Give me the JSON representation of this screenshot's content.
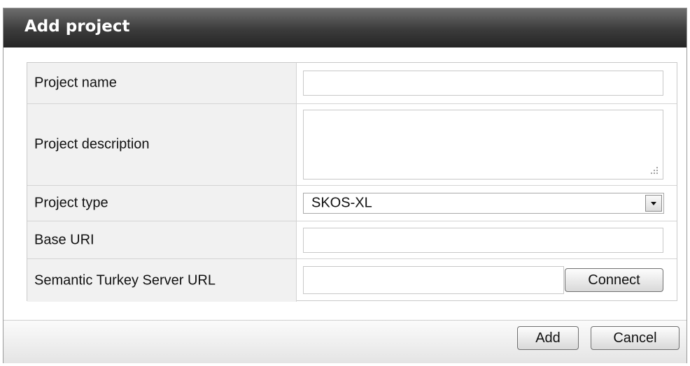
{
  "dialog": {
    "title": "Add project"
  },
  "form": {
    "project_name": {
      "label": "Project name",
      "value": ""
    },
    "project_description": {
      "label": "Project description",
      "value": ""
    },
    "project_type": {
      "label": "Project type",
      "selected": "SKOS-XL"
    },
    "base_uri": {
      "label": "Base URI",
      "value": ""
    },
    "server_url": {
      "label": "Semantic Turkey Server URL",
      "value": "",
      "connect_label": "Connect"
    }
  },
  "footer": {
    "add_label": "Add",
    "cancel_label": "Cancel"
  },
  "icons": {
    "dropdown": "chevron-down-icon",
    "resize": "resize-grip-icon"
  }
}
